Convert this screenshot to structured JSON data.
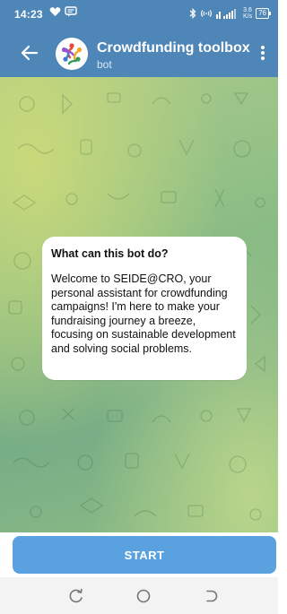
{
  "status_bar": {
    "time": "14:23",
    "left_icons": [
      "heart-icon",
      "message-icon"
    ],
    "right_icons": [
      "bluetooth-icon",
      "wifi-calling-icon",
      "signal-icon"
    ],
    "network_speed_value": "3.6",
    "network_speed_unit": "K/s",
    "battery": "76"
  },
  "header": {
    "title": "Crowdfunding toolbox",
    "subtitle": "bot",
    "background": "#4f86b8"
  },
  "info_card": {
    "heading": "What can this bot do?",
    "body": "Welcome to SEIDE@CRO, your personal assistant for crowdfunding campaigns! I'm here to make your fundraising journey a breeze, focusing on sustainable development and solving social problems."
  },
  "actions": {
    "start_label": "START",
    "start_color": "#5aa1e0"
  },
  "nav_bar": {
    "buttons": [
      "recent-apps-icon",
      "home-icon",
      "back-icon"
    ]
  }
}
